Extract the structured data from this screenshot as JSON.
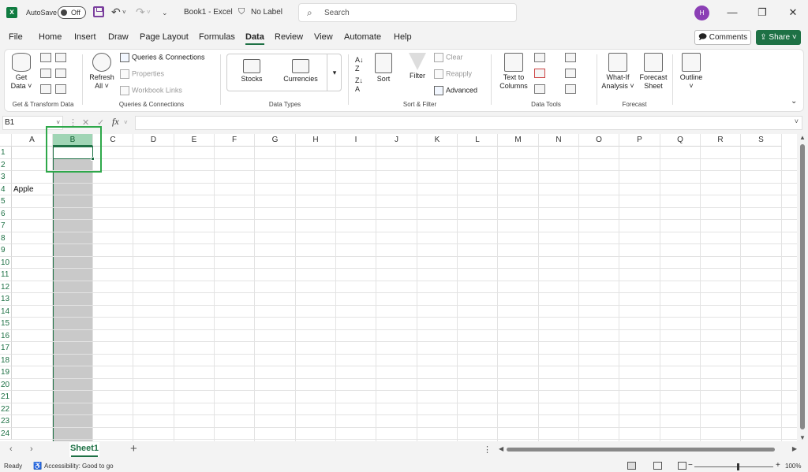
{
  "titlebar": {
    "autosave_label": "AutoSave",
    "autosave_state": "Off",
    "doc_title": "Book1  -  Excel",
    "sensitivity_label": "No Label",
    "search_placeholder": "Search",
    "avatar_initial": "H",
    "minimize": "—",
    "restore": "❐",
    "close": "✕"
  },
  "menu": {
    "tabs": [
      "File",
      "Home",
      "Insert",
      "Draw",
      "Page Layout",
      "Formulas",
      "Data",
      "Review",
      "View",
      "Automate",
      "Help"
    ],
    "active_tab": "Data",
    "comments_label": "Comments",
    "share_label": "Share"
  },
  "ribbon": {
    "get_data": {
      "line1": "Get",
      "line2": "Data ˅"
    },
    "refresh_all": {
      "line1": "Refresh",
      "line2": "All ˅"
    },
    "queries_connections": "Queries & Connections",
    "properties": "Properties",
    "workbook_links": "Workbook Links",
    "stocks": "Stocks",
    "currencies": "Currencies",
    "sort": "Sort",
    "filter": "Filter",
    "clear": "Clear",
    "reapply": "Reapply",
    "advanced": "Advanced",
    "text_to_columns": {
      "line1": "Text to",
      "line2": "Columns"
    },
    "what_if": {
      "line1": "What-If",
      "line2": "Analysis ˅"
    },
    "forecast_sheet": {
      "line1": "Forecast",
      "line2": "Sheet"
    },
    "outline": {
      "line1": "Outline",
      "line2": "˅"
    },
    "group_labels": {
      "get_transform": "Get & Transform Data",
      "queries": "Queries & Connections",
      "data_types": "Data Types",
      "sort_filter": "Sort & Filter",
      "data_tools": "Data Tools",
      "forecast": "Forecast"
    }
  },
  "formula_bar": {
    "name_box": "B1",
    "fx": "fx",
    "value": ""
  },
  "grid": {
    "columns": [
      "A",
      "B",
      "C",
      "D",
      "E",
      "F",
      "G",
      "H",
      "I",
      "J",
      "K",
      "L",
      "M",
      "N",
      "O",
      "P",
      "Q",
      "R",
      "S"
    ],
    "selected_column": "B",
    "rows": [
      "1",
      "2",
      "3",
      "4",
      "5",
      "6",
      "7",
      "8",
      "9",
      "10",
      "11",
      "12",
      "13",
      "14",
      "15",
      "16",
      "17",
      "18",
      "19",
      "20",
      "21",
      "22",
      "23",
      "24"
    ],
    "cells": {
      "A4": "Apple"
    }
  },
  "sheets": {
    "tabs": [
      "Sheet1"
    ],
    "active": "Sheet1",
    "add": "+"
  },
  "status": {
    "ready": "Ready",
    "accessibility": "Accessibility: Good to go",
    "zoom_minus": "−",
    "zoom_plus": "+",
    "zoom_level": "100%"
  }
}
